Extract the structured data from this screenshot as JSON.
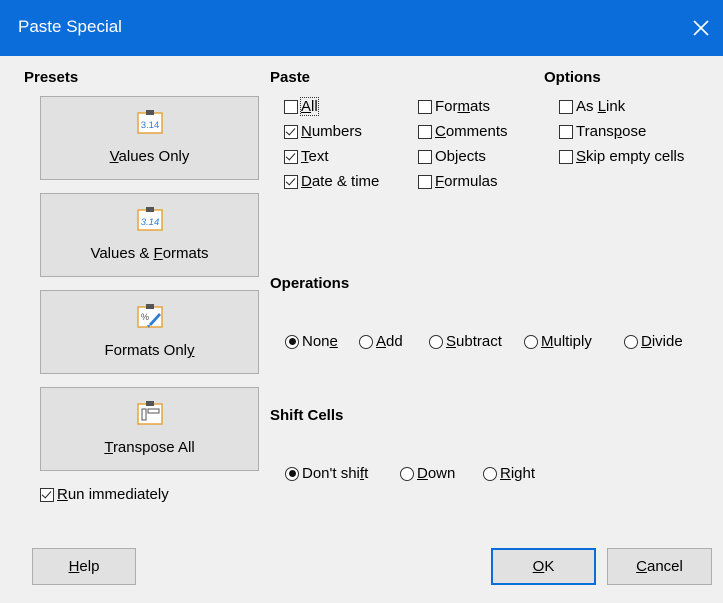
{
  "window": {
    "title": "Paste Special",
    "close_symbol": "✕"
  },
  "presets": {
    "heading": "Presets",
    "items": [
      {
        "id": "values-only",
        "pre": "",
        "mn": "V",
        "post": "alues Only",
        "icon": "clipboard-number-icon"
      },
      {
        "id": "values-formats",
        "pre": "Values & ",
        "mn": "F",
        "post": "ormats",
        "icon": "clipboard-number-formatted-icon"
      },
      {
        "id": "formats-only",
        "pre": "Formats Onl",
        "mn": "y",
        "post": "",
        "icon": "clipboard-format-brush-icon"
      },
      {
        "id": "transpose-all",
        "pre": "",
        "mn": "T",
        "post": "ranspose All",
        "icon": "clipboard-transpose-icon"
      }
    ],
    "icon_text": "3.14",
    "icon_pct": "%",
    "run_immediately": {
      "pre": "",
      "mn": "R",
      "post": "un immediately",
      "checked": true
    }
  },
  "paste": {
    "heading": "Paste",
    "items": [
      {
        "id": "all",
        "pre": "",
        "mn": "A",
        "post": "ll",
        "checked": false
      },
      {
        "id": "numbers",
        "pre": "",
        "mn": "N",
        "post": "umbers",
        "checked": true
      },
      {
        "id": "text",
        "pre": "",
        "mn": "T",
        "post": "ext",
        "checked": true
      },
      {
        "id": "date-time",
        "pre": "",
        "mn": "D",
        "post": "ate & time",
        "checked": true
      },
      {
        "id": "formats",
        "pre": "For",
        "mn": "m",
        "post": "ats",
        "checked": false
      },
      {
        "id": "comments",
        "pre": "",
        "mn": "C",
        "post": "omments",
        "checked": false
      },
      {
        "id": "objects",
        "pre": "Ob",
        "mn": "j",
        "post": "ects",
        "checked": false
      },
      {
        "id": "formulas",
        "pre": "",
        "mn": "F",
        "post": "ormulas",
        "checked": false
      }
    ]
  },
  "options": {
    "heading": "Options",
    "items": [
      {
        "id": "as-link",
        "pre": "As ",
        "mn": "L",
        "post": "ink",
        "checked": false
      },
      {
        "id": "transpose",
        "pre": "Trans",
        "mn": "p",
        "post": "ose",
        "checked": false
      },
      {
        "id": "skip-empty",
        "pre": "",
        "mn": "S",
        "post": "kip empty cells",
        "checked": false
      }
    ]
  },
  "operations": {
    "heading": "Operations",
    "items": [
      {
        "id": "none",
        "pre": "Non",
        "mn": "e",
        "post": "",
        "checked": true
      },
      {
        "id": "add",
        "pre": "",
        "mn": "A",
        "post": "dd",
        "checked": false
      },
      {
        "id": "subtract",
        "pre": "",
        "mn": "S",
        "post": "ubtract",
        "checked": false
      },
      {
        "id": "multiply",
        "pre": "",
        "mn": "M",
        "post": "ultiply",
        "checked": false
      },
      {
        "id": "divide",
        "pre": "",
        "mn": "D",
        "post": "ivide",
        "checked": false
      }
    ]
  },
  "shift_cells": {
    "heading": "Shift Cells",
    "items": [
      {
        "id": "dont-shift",
        "pre": "Don't shi",
        "mn": "f",
        "post": "t",
        "checked": true
      },
      {
        "id": "down",
        "pre": "",
        "mn": "D",
        "post": "own",
        "checked": false
      },
      {
        "id": "right",
        "pre": "",
        "mn": "R",
        "post": "ight",
        "checked": false
      }
    ]
  },
  "buttons": {
    "help": {
      "pre": "",
      "mn": "H",
      "post": "elp"
    },
    "ok": {
      "pre": "",
      "mn": "O",
      "post": "K"
    },
    "cancel": {
      "pre": "",
      "mn": "C",
      "post": "ancel"
    }
  },
  "colors": {
    "titlebar": "#0a6dd9",
    "dialog_bg": "#f0f0f0",
    "button_bg": "#e1e1e1",
    "icon_orange": "#e8a33c",
    "icon_blue": "#2e7dd6"
  }
}
